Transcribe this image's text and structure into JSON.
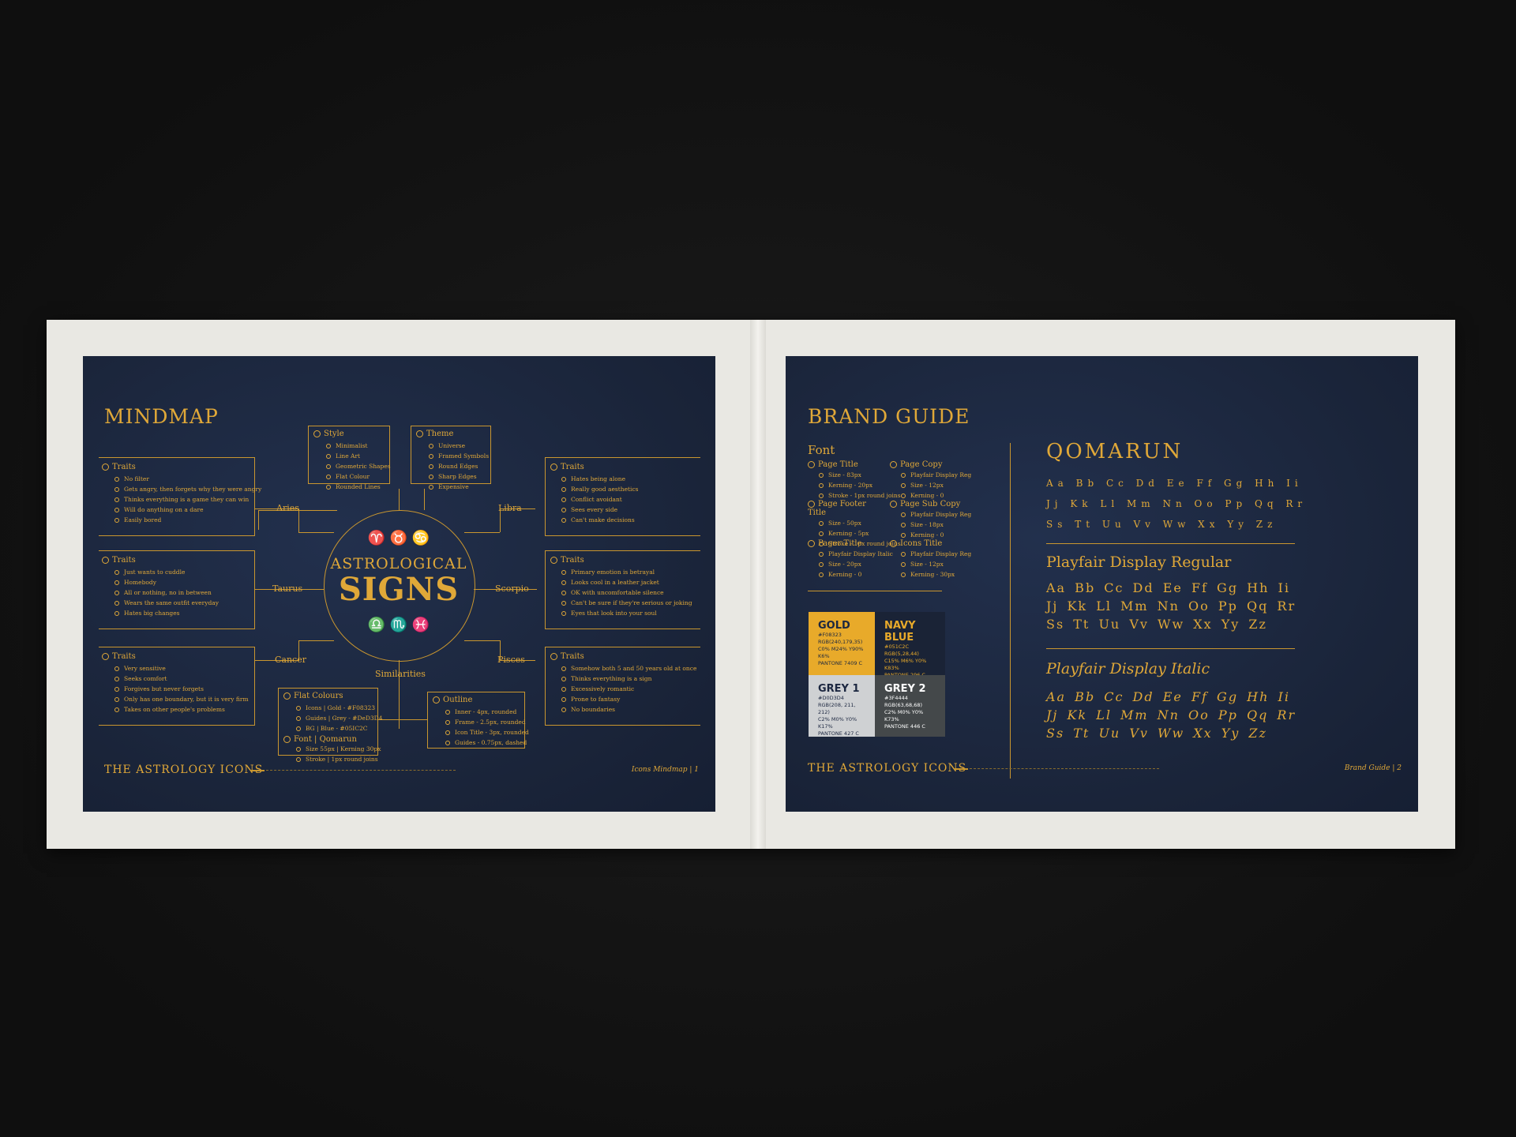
{
  "left_page": {
    "title": "MINDMAP",
    "center": {
      "line1": "ASTROLOGICAL",
      "line2": "SIGNS",
      "top_icons": "♈ ♉ ♋",
      "bottom_icons": "♎ ♏ ♓"
    },
    "style_box": {
      "heading": "Style",
      "items": [
        "Minimalist",
        "Line Art",
        "Geometric Shapes",
        "Flat Colour",
        "Rounded Lines"
      ]
    },
    "theme_box": {
      "heading": "Theme",
      "items": [
        "Universe",
        "Framed Symbols",
        "Round Edges",
        "Sharp Edges",
        "Expensive"
      ]
    },
    "aries": {
      "label": "Aries",
      "heading": "Traits",
      "items": [
        "No filter",
        "Gets angry, then forgets why they were angry",
        "Thinks everything is a game they can win",
        "Will do anything on a dare",
        "Easily bored"
      ]
    },
    "taurus": {
      "label": "Taurus",
      "heading": "Traits",
      "items": [
        "Just wants to cuddle",
        "Homebody",
        "All or nothing, no in between",
        "Wears the same outfit everyday",
        "Hates big changes"
      ]
    },
    "cancer": {
      "label": "Cancer",
      "heading": "Traits",
      "items": [
        "Very sensitive",
        "Seeks comfort",
        "Forgives but never forgets",
        "Only has one boundary, but it is very firm",
        "Takes on other people's problems"
      ]
    },
    "libra": {
      "label": "Libra",
      "heading": "Traits",
      "items": [
        "Hates being alone",
        "Really good aesthetics",
        "Conflict avoidant",
        "Sees every side",
        "Can't make decisions"
      ]
    },
    "scorpio": {
      "label": "Scorpio",
      "heading": "Traits",
      "items": [
        "Primary emotion is betrayal",
        "Looks cool in a leather jacket",
        "OK with uncomfortable silence",
        "Can't be sure if they're serious or joking",
        "Eyes that look into your soul"
      ]
    },
    "pisces": {
      "label": "Pisces",
      "heading": "Traits",
      "items": [
        "Somehow both 5 and 50 years old at once",
        "Thinks everything is a sign",
        "Excessively romantic",
        "Prone to fantasy",
        "No boundaries"
      ]
    },
    "similarities": {
      "label": "Similarities",
      "flat": {
        "heading": "Flat Colours",
        "items": [
          "Icons | Gold - #F08323",
          "Guides | Grey - #DeD3D4",
          "BG | Blue - #05IC2C"
        ]
      },
      "font": {
        "heading": "Font | Qomarun",
        "items": [
          "Size 55px | Kerning 30px",
          "Stroke | 1px round joins"
        ]
      },
      "outline": {
        "heading": "Outline",
        "items": [
          "Inner - 4px, rounded",
          "Frame - 2.5px, rounded",
          "Icon Title - 3px, rounded",
          "Guides - 0.75px, dashed"
        ]
      }
    },
    "footer_title": "THE ASTROLOGY ICONS",
    "footer_right": "Icons Mindmap | 1"
  },
  "right_page": {
    "title": "BRAND GUIDE",
    "font_heading": "Font",
    "font_items": [
      {
        "heading": "Page Title",
        "items": [
          "Size - 83px",
          "Kerning - 20px",
          "Stroke - 1px round joins"
        ]
      },
      {
        "heading": "Page Copy",
        "items": [
          "Playfair Display Reg",
          "Size - 12px",
          "Kerning - 0"
        ]
      },
      {
        "heading": "Page Footer Title",
        "items": [
          "Size - 50px",
          "Kerning - 5px",
          "Stroke - 1px round joins"
        ]
      },
      {
        "heading": "Page Sub Copy",
        "items": [
          "Playfair Display Reg",
          "Size - 18px",
          "Kerning - 0"
        ]
      },
      {
        "heading": "Pager Title",
        "items": [
          "Playfair Display Italic",
          "Size - 20px",
          "Kerning - 0"
        ]
      },
      {
        "heading": "Icons Title",
        "items": [
          "Playfair Display Reg",
          "Size - 12px",
          "Kerning - 30px"
        ]
      }
    ],
    "swatches": [
      {
        "name": "GOLD",
        "hex": "#F08323",
        "rgb": "RGB(240,179,35)",
        "cmyk": "C0% M24% Y90% K6%",
        "pantone": "PANTONE 7409 C",
        "color": "#e8aa2a",
        "text": "#1c2740"
      },
      {
        "name": "NAVY BLUE",
        "hex": "#051C2C",
        "rgb": "RGB(5,28,44)",
        "cmyk": "C15% M6% Y0% K83%",
        "pantone": "PANTONE 296 C",
        "color": "#1a2336",
        "text": "#e8aa2a"
      },
      {
        "name": "GREY 1",
        "hex": "#D0D3D4",
        "rgb": "RGB(208, 211, 212)",
        "cmyk": "C2% M0% Y0% K17%",
        "pantone": "PANTONE 427 C",
        "color": "#cfd1d3",
        "text": "#1c2740"
      },
      {
        "name": "GREY 2",
        "hex": "#3F4444",
        "rgb": "RGB(63,68,68)",
        "cmyk": "C2% M0% Y0% K73%",
        "pantone": "PANTONE 446 C",
        "color": "#44484a",
        "text": "#ffffff"
      }
    ],
    "font1_name": "QOMARUN",
    "font1_rows": [
      "Aa Bb Cc Dd Ee Ff Gg Hh Ii",
      "Jj Kk Ll Mm Nn Oo Pp Qq Rr",
      "Ss Tt Uu Vv Ww Xx Yy Zz"
    ],
    "font2_name": "Playfair Display Regular",
    "font2_rows": [
      "Aa Bb Cc Dd Ee Ff Gg Hh Ii",
      "Jj Kk Ll Mm Nn Oo Pp Qq Rr",
      "Ss Tt Uu Vv Ww Xx Yy Zz"
    ],
    "font3_name": "Playfair Display Italic",
    "font3_rows": [
      "Aa Bb Cc Dd Ee Ff Gg Hh Ii",
      "Jj Kk Ll Mm Nn Oo Pp Qq Rr",
      "Ss Tt Uu Vv Ww Xx Yy Zz"
    ],
    "footer_title": "THE ASTROLOGY ICONS",
    "footer_right": "Brand Guide | 2"
  }
}
